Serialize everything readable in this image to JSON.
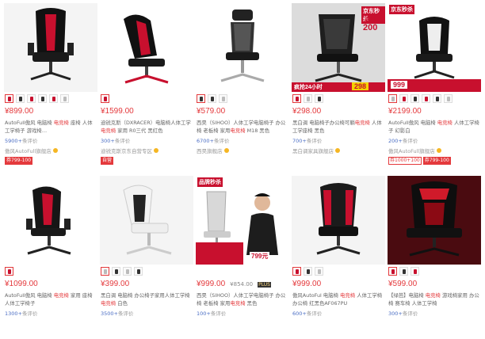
{
  "products": [
    {
      "price": "¥899.00",
      "title_a": "AutoFull傲风 电脑椅 ",
      "title_hl": "电竞椅",
      "title_b": " 座椅 人体工学椅子 游戏椅…",
      "comments_count": "5900+",
      "comments_suffix": "条评价",
      "shop": "傲风AutoFull旗舰店",
      "tags": [
        "券799-100"
      ]
    },
    {
      "price": "¥1599.00",
      "title_a": "迪锐克斯（DXRACER）电脑椅人体工学",
      "title_hl": "电竞椅",
      "title_b": " 家用 R0三代 黑红色",
      "comments_count": "300+",
      "comments_suffix": "条评价",
      "shop": "迪锐克斯京东自营专区",
      "tags": [
        "自营"
      ]
    },
    {
      "price": "¥579.00",
      "title_a": "西昊（SIHOO）人体工学电脑椅子 办公椅 老板椅 家用",
      "title_hl": "电竞椅",
      "title_b": " M18 黑色",
      "comments_count": "6700+",
      "comments_suffix": "条评价",
      "shop": "西昊旗舰店",
      "tags": []
    },
    {
      "price": "¥298.00",
      "title_a": "黑白调 电脑椅子办公椅可躺",
      "title_hl": "电竞椅",
      "title_b": " 人体工学座椅 黑色",
      "comments_count": "700+",
      "comments_suffix": "条评价",
      "shop": "黑白调家具旗舰店",
      "tags": []
    },
    {
      "price": "¥2199.00",
      "title_a": "AutoFull傲风 电脑椅 ",
      "title_hl": "电竞椅",
      "title_b": " 人体工学椅子 幻影白",
      "comments_count": "200+",
      "comments_suffix": "条评价",
      "shop": "傲风AutoFull旗舰店",
      "tags": [
        "券1000+100",
        "券799-100"
      ]
    },
    {
      "price": "¥1099.00",
      "title_a": "AutoFull傲风 电脑椅 ",
      "title_hl": "电竞椅",
      "title_b": " 家用 座椅人体工学椅子",
      "comments_count": "1300+",
      "comments_suffix": "条评价",
      "shop": "",
      "tags": []
    },
    {
      "price": "¥399.00",
      "title_a": "黑白调 电脑椅 办公椅子家用人体工学椅",
      "title_hl": " 电竞椅",
      "title_b": " 白色",
      "comments_count": "3500+",
      "comments_suffix": "条评价",
      "shop": "",
      "tags": []
    },
    {
      "price": "¥999.00",
      "orig_price": "¥854.00",
      "plus_label": "PLUS",
      "title_a": "西昊（SIHOO）人体工学电脑椅子 办公椅 老板椅 家用",
      "title_hl": "电竞椅",
      "title_b": " 黑色",
      "comments_count": "100+",
      "comments_suffix": "条评价",
      "shop": "",
      "tags": []
    },
    {
      "price": "¥999.00",
      "title_a": "傲风AutoFul 电脑椅 ",
      "title_hl": "电竞椅",
      "title_b": " 人体工学椅 办公椅 红黑色AF067PU",
      "comments_count": "600+",
      "comments_suffix": "条评价",
      "shop": "",
      "tags": []
    },
    {
      "price": "¥599.00",
      "title_a": "【绿芭】电脑椅 ",
      "title_hl": "电竞椅",
      "title_b": " 游戏椅家用 办公椅 赛车椅 人体工学椅",
      "comments_count": "300+",
      "comments_suffix": "条评价",
      "shop": "",
      "tags": []
    }
  ],
  "badges": {
    "p4_top": "京东秒杀",
    "p4_mid": "直降",
    "p4_amount": "200",
    "p4_sale": "疯抢24小时",
    "p4_price": "298",
    "p5_top": "京东秒杀",
    "p5_price": "999",
    "p8_top": "品牌秒杀",
    "p8_price": "799元"
  },
  "colors": {
    "accent": "#e4393c",
    "link": "#4a6dc4",
    "shop_dot": "#f5b623"
  }
}
